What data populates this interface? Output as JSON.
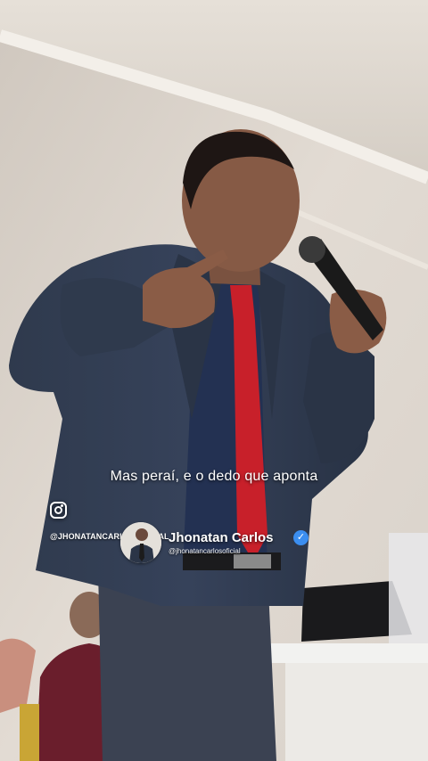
{
  "caption": "Mas peraí, e o dedo que aponta",
  "instagram": {
    "icon": "instagram-icon",
    "handle": "@JHONATANCARLOSOFICIAL"
  },
  "profile": {
    "name": "Jhonatan Carlos",
    "handle": "@jhonatancarlosoficial",
    "verified_icon": "verified-badge-icon",
    "verified_color": "#3b8ef0"
  },
  "colors": {
    "suit": "#2b3547",
    "tie": "#c8202a",
    "wall": "#ddd6ce"
  }
}
